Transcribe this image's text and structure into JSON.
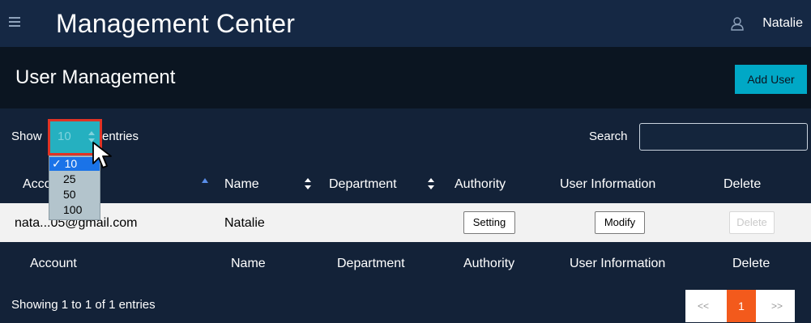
{
  "header": {
    "app_title": "Management Center",
    "user_name": "Natalie",
    "menu_icon": "hamburger-menu-icon",
    "user_icon": "user-icon"
  },
  "section": {
    "title": "User Management",
    "add_user_label": "Add User"
  },
  "controls": {
    "show_label": "Show",
    "entries_label": "entries",
    "page_length_value": "10",
    "page_length_options": [
      "10",
      "25",
      "50",
      "100"
    ],
    "selected_option_label": "✓ 10",
    "search_label": "Search",
    "search_value": ""
  },
  "table": {
    "headers": {
      "account": "Account",
      "name": "Name",
      "department": "Department",
      "authority": "Authority",
      "user_information": "User Information",
      "delete": "Delete"
    },
    "rows": [
      {
        "account": "nata...05@gmail.com",
        "name": "Natalie",
        "department": "",
        "authority_button": "Setting",
        "user_info_button": "Modify",
        "delete_button": "Delete"
      }
    ],
    "footer": {
      "account": "Account",
      "name": "Name",
      "department": "Department",
      "authority": "Authority",
      "user_information": "User Information",
      "delete": "Delete"
    }
  },
  "status": {
    "info": "Showing 1 to 1 of 1 entries"
  },
  "pagination": {
    "prev": "<<",
    "current": "1",
    "next": ">>"
  },
  "colors": {
    "topbar": "#152844",
    "section_header": "#0b1521",
    "table_bg": "#132238",
    "accent": "#00a8c6",
    "highlight_border": "#e03325",
    "active_page": "#f35a1c"
  }
}
